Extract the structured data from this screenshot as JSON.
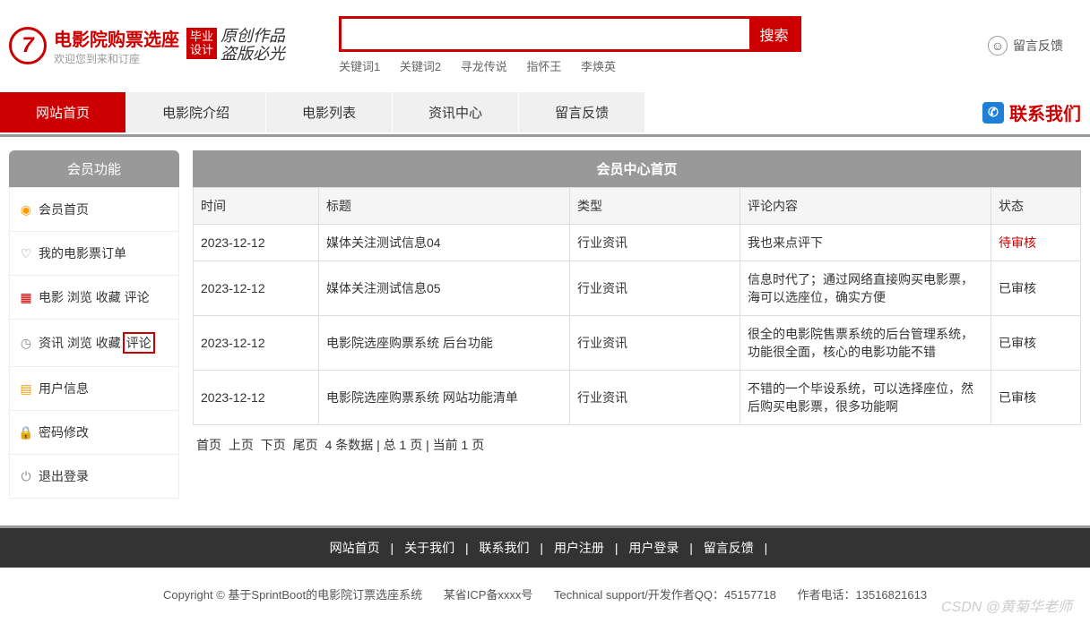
{
  "brand": {
    "title": "电影院购票选座",
    "subtitle": "欢迎您到来和订座",
    "badge": "毕业\n设计",
    "script1": "原创作品",
    "script2": "盗版必光"
  },
  "search": {
    "button": "搜索",
    "placeholder": "",
    "keywords": [
      "关键词1",
      "关键词2",
      "寻龙传说",
      "指怀王",
      "李焕英"
    ]
  },
  "header_feedback": "留言反馈",
  "nav": {
    "items": [
      "网站首页",
      "电影院介绍",
      "电影列表",
      "资讯中心",
      "留言反馈"
    ],
    "contact": "联系我们"
  },
  "sidebar": {
    "title": "会员功能",
    "items": [
      {
        "label": "会员首页"
      },
      {
        "label": "我的电影票订单"
      },
      {
        "prefix": "电影",
        "sub": "浏览 收藏 评论"
      },
      {
        "prefix": "资讯",
        "sub": "浏览 收藏",
        "highlight": "评论"
      },
      {
        "label": "用户信息"
      },
      {
        "label": "密码修改"
      },
      {
        "label": "退出登录"
      }
    ]
  },
  "main": {
    "title": "会员中心首页",
    "columns": [
      "时间",
      "标题",
      "类型",
      "评论内容",
      "状态"
    ],
    "rows": [
      {
        "time": "2023-12-12",
        "title": "媒体关注测试信息04",
        "type": "行业资讯",
        "content": "我也来点评下",
        "status": "待审核",
        "pending": true
      },
      {
        "time": "2023-12-12",
        "title": "媒体关注测试信息05",
        "type": "行业资讯",
        "content": "信息时代了；通过网络直接购买电影票，海可以选座位，确实方便",
        "status": "已审核"
      },
      {
        "time": "2023-12-12",
        "title": "电影院选座购票系统 后台功能",
        "type": "行业资讯",
        "content": "很全的电影院售票系统的后台管理系统，功能很全面，核心的电影功能不错",
        "status": "已审核"
      },
      {
        "time": "2023-12-12",
        "title": "电影院选座购票系统 网站功能清单",
        "type": "行业资讯",
        "content": "不错的一个毕设系统，可以选择座位，然后购买电影票，很多功能啊",
        "status": "已审核"
      }
    ],
    "pagination": {
      "links": [
        "首页",
        "上页",
        "下页",
        "尾页"
      ],
      "info": "4 条数据 | 总 1 页 | 当前 1 页"
    }
  },
  "footer": {
    "links": [
      "网站首页",
      "关于我们",
      "联系我们",
      "用户注册",
      "用户登录",
      "留言反馈"
    ],
    "copyright": "Copyright © 基于SprintBoot的电影院订票选座系统",
    "icp": "某省ICP备xxxx号",
    "support": "Technical support/开发作者QQ：45157718",
    "phone": "作者电话：13516821613"
  },
  "watermark": "CSDN @黄菊华老师"
}
